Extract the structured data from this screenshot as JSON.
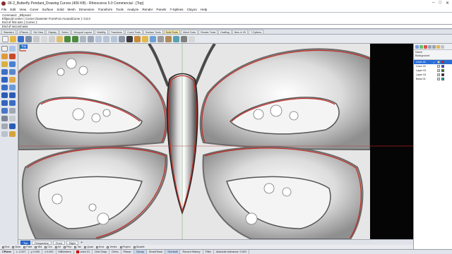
{
  "window": {
    "title": "06-2_Butterfly Pendant_Drawing Curves (406 KB) - Rhinoceros 5.0 Commercial - [Top]",
    "controls": [
      "–",
      "□",
      "✕"
    ]
  },
  "menu": [
    "File",
    "Edit",
    "View",
    "Curve",
    "Surface",
    "Solid",
    "Mesh",
    "Dimension",
    "Transform",
    "Tools",
    "Analyze",
    "Render",
    "Panels",
    "T-Splines",
    "Clayoo",
    "Help"
  ],
  "command": {
    "history": [
      "Command: _Ellipsoid",
      "Ellipsoid center ( Corner  Diameter  FromFoci  AroundCurve ): 0,0,0",
      "End of first axis ( Corner ):",
      "End of second axis:"
    ],
    "prompt": "End of second axis"
  },
  "toolbar_tabs": {
    "items": [
      "Standard",
      "CPlanes",
      "Set View",
      "Display",
      "Select",
      "Viewport Layout",
      "Visibility",
      "Transform",
      "Curve Tools",
      "Surface Tools",
      "Solid Tools",
      "Mesh Tools",
      "Render Tools",
      "Drafting",
      "New in V5",
      "T-Splines"
    ],
    "active": "Solid Tools"
  },
  "viewport": {
    "label": "Top",
    "tabs": [
      "Top",
      "Perspective",
      "Front",
      "Right"
    ],
    "active_tab": "Top",
    "add_tab": "+"
  },
  "osnaps": [
    "End",
    "Near",
    "Point",
    "Mid",
    "Cen",
    "Int",
    "Perp",
    "Tan",
    "Quad",
    "Knot",
    "Vertex",
    "Project",
    "Disable"
  ],
  "layers": {
    "header_name": "Name",
    "parent": "Background",
    "rows": [
      {
        "name": "Lines 01",
        "current": true,
        "selected": true,
        "color": "#d81b1b"
      },
      {
        "name": "Lines 02",
        "current": false,
        "selected": false,
        "color": "#3a3aff"
      },
      {
        "name": "Layer 03",
        "current": false,
        "selected": false,
        "color": "#2d8f2d"
      },
      {
        "name": "Layer 04",
        "current": false,
        "selected": false,
        "color": "#1a1a1a"
      },
      {
        "name": "Bead 01",
        "current": false,
        "selected": false,
        "color": "#13c0c0"
      }
    ]
  },
  "status": {
    "cplane": "CPlane",
    "x": "x -2.527",
    "y": "y 0.000",
    "z": "z 0.000",
    "units": "Millimeters",
    "layer": "Lines 01",
    "toggles": [
      {
        "label": "Grid Snap",
        "on": false
      },
      {
        "label": "Ortho",
        "on": false
      },
      {
        "label": "Planar",
        "on": false
      },
      {
        "label": "Osnap",
        "on": true
      },
      {
        "label": "SmartTrack",
        "on": false
      },
      {
        "label": "Gumball",
        "on": true
      },
      {
        "label": "Record History",
        "on": false
      },
      {
        "label": "Filter",
        "on": false
      }
    ],
    "tolerance": "Absolute tolerance: 0.001"
  },
  "colors": {
    "accent": "#2b6dd6",
    "curve": "#c0302a",
    "toolbar_active": "#f5e9a8"
  }
}
